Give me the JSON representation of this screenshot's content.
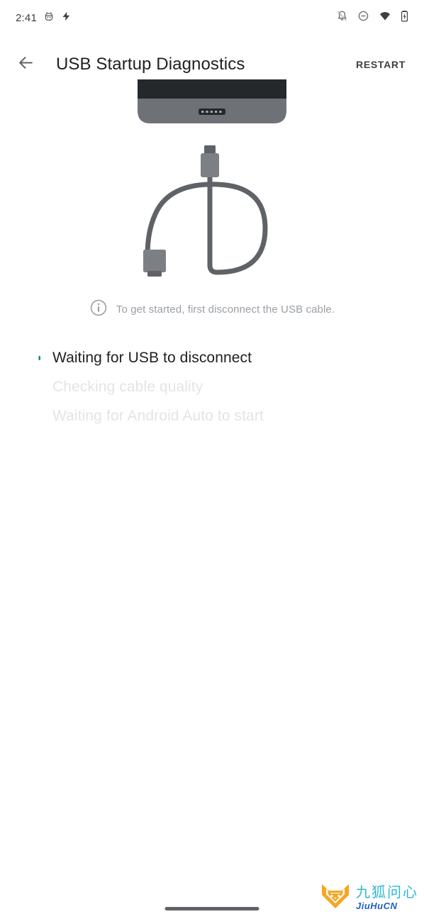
{
  "status_bar": {
    "clock": "2:41",
    "left_icons": [
      "android-debug-icon",
      "usb-charging-bolt-icon"
    ],
    "right_icons": [
      "notifications-silenced-icon",
      "do-not-disturb-icon",
      "wifi-icon",
      "battery-charging-icon"
    ]
  },
  "app_bar": {
    "back_icon": "back-arrow-icon",
    "title": "USB Startup Diagnostics",
    "action_label": "RESTART"
  },
  "illustration": {
    "name": "usb-cable-disconnect-illustration",
    "device_body_color": "#6e7277",
    "device_screen_color": "#25282b",
    "cable_color": "#5f6368",
    "connector_color": "#7c8085",
    "port_color": "#25282b",
    "port_pin_count": 5
  },
  "hint": {
    "icon": "info-circle-icon",
    "text": "To get started, first disconnect the USB cable."
  },
  "steps": [
    {
      "label": "Waiting for USB to disconnect",
      "state": "active",
      "spinner_color": "#1a8a6e"
    },
    {
      "label": "Checking cable quality",
      "state": "pending"
    },
    {
      "label": "Waiting for Android Auto to start",
      "state": "pending"
    }
  ],
  "watermark": {
    "logo_icon": "fox-head-logo-icon",
    "cn_text": "九狐问心",
    "en_text": "JiuHuCN",
    "logo_color": "#f5a623",
    "cn_color": "#2fb8d4",
    "en_color": "#1d5fc4"
  },
  "nav_bar": {
    "pill": "gesture-nav-pill"
  }
}
